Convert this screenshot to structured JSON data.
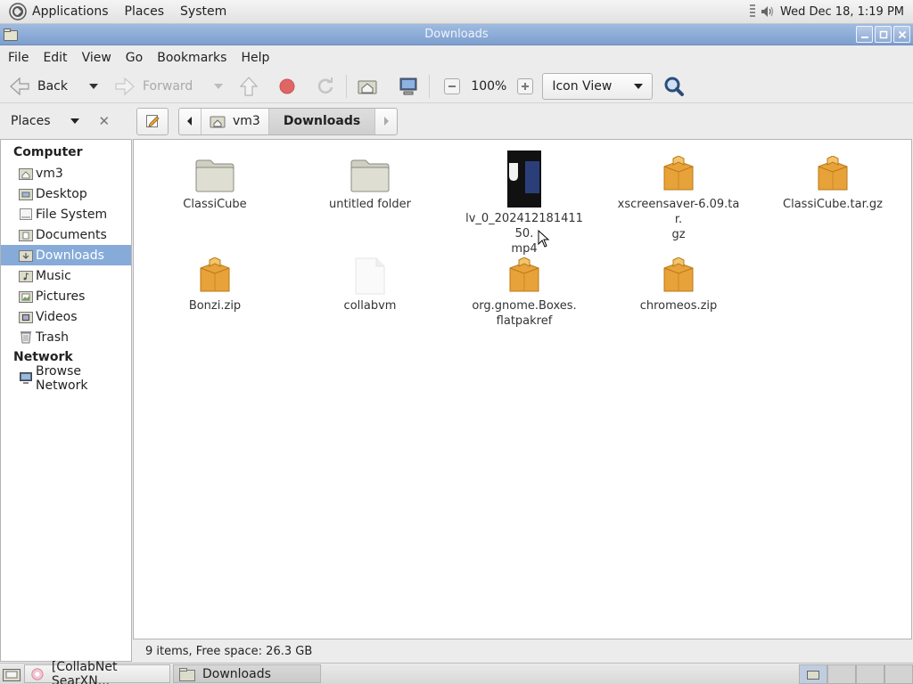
{
  "top_panel": {
    "menus": [
      "Applications",
      "Places",
      "System"
    ],
    "clock": "Wed Dec 18,  1:19 PM",
    "icons": {
      "logo": "gnome-foot-icon",
      "volume": "volume-icon"
    }
  },
  "window": {
    "title": "Downloads",
    "menubar": [
      "File",
      "Edit",
      "View",
      "Go",
      "Bookmarks",
      "Help"
    ]
  },
  "toolbar": {
    "back_label": "Back",
    "forward_label": "Forward",
    "zoom": "100%",
    "view_mode": "Icon View"
  },
  "location": {
    "places_label": "Places",
    "crumbs": [
      "vm3",
      "Downloads"
    ]
  },
  "sidebar": {
    "computer_heading": "Computer",
    "computer_items": [
      {
        "label": "vm3",
        "icon": "home-folder-icon"
      },
      {
        "label": "Desktop",
        "icon": "desktop-folder-icon"
      },
      {
        "label": "File System",
        "icon": "drive-icon"
      },
      {
        "label": "Documents",
        "icon": "folder-icon"
      },
      {
        "label": "Downloads",
        "icon": "folder-icon",
        "selected": true
      },
      {
        "label": "Music",
        "icon": "folder-icon"
      },
      {
        "label": "Pictures",
        "icon": "folder-icon"
      },
      {
        "label": "Videos",
        "icon": "folder-icon"
      },
      {
        "label": "Trash",
        "icon": "trash-icon"
      }
    ],
    "network_heading": "Network",
    "network_items": [
      {
        "label": "Browse Network",
        "icon": "network-icon"
      }
    ]
  },
  "files": [
    {
      "name": "ClassiCube",
      "type": "folder"
    },
    {
      "name": "untitled folder",
      "type": "folder"
    },
    {
      "name": "lv_0_20241218141150.\nmp4",
      "type": "video"
    },
    {
      "name": "xscreensaver-6.09.tar.\ngz",
      "type": "archive"
    },
    {
      "name": "ClassiCube.tar.gz",
      "type": "archive"
    },
    {
      "name": "Bonzi.zip",
      "type": "archive"
    },
    {
      "name": "collabvm",
      "type": "blank"
    },
    {
      "name": "org.gnome.Boxes.\nflatpakref",
      "type": "archive"
    },
    {
      "name": "chromeos.zip",
      "type": "archive"
    }
  ],
  "status": "9 items, Free space: 26.3 GB",
  "taskbar": {
    "tasks": [
      "[CollabNet SearXN...",
      "Downloads"
    ]
  },
  "colors": {
    "selection": "#86abd9",
    "titlebar": "#8eaad3"
  }
}
